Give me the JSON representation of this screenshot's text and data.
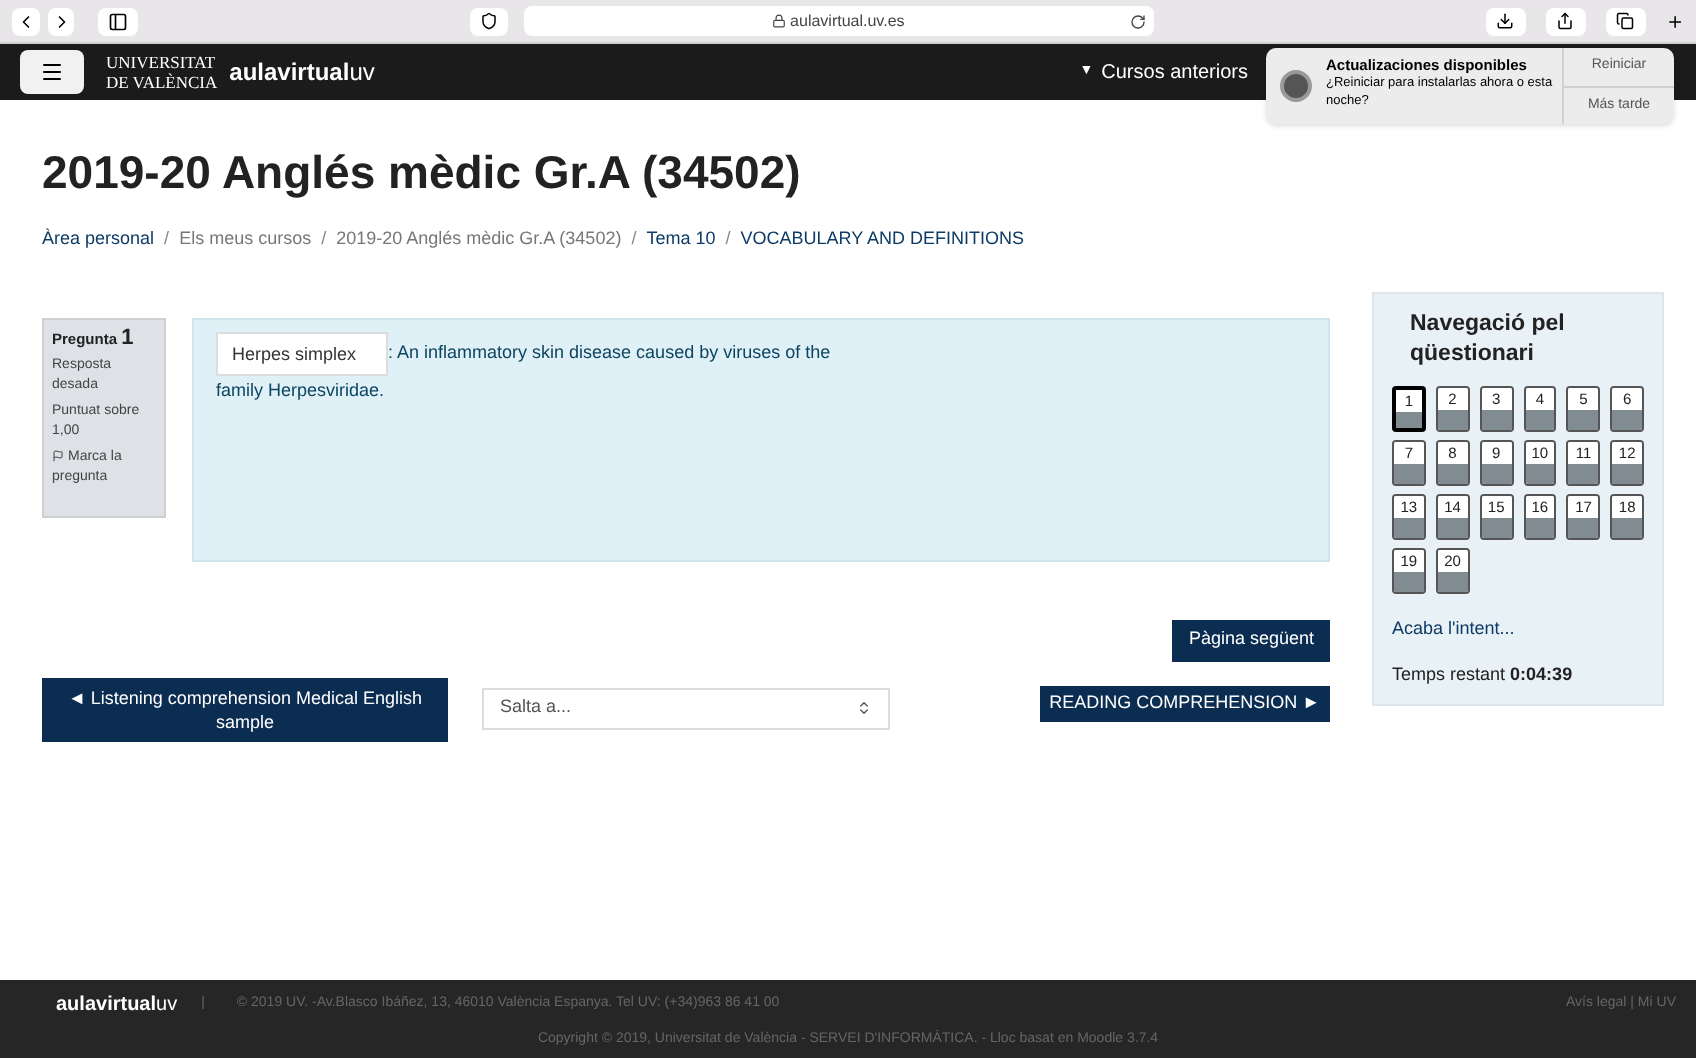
{
  "browser": {
    "url": "aulavirtual.uv.es"
  },
  "navbar": {
    "university": [
      "UNIVERSITAT",
      "DE VALÈNCIA"
    ],
    "logo": {
      "main": "aulavirtual",
      "suffix": "uv"
    },
    "menu_caret": "▼",
    "menu": "Cursos anteriors"
  },
  "notification": {
    "title": "Actualizaciones disponibles",
    "message": "¿Reiniciar para instalarlas ahora o esta noche?",
    "actions": [
      "Reiniciar",
      "Más tarde"
    ]
  },
  "page_title": "2019-20 Anglés mèdic Gr.A (34502)",
  "breadcrumb": {
    "separators": [
      "/",
      "/",
      "/",
      "/"
    ],
    "items": [
      {
        "label": "Àrea personal",
        "link": true
      },
      {
        "label": "Els meus cursos",
        "link": false
      },
      {
        "label": "2019-20 Anglés mèdic Gr.A (34502)",
        "link": false
      },
      {
        "label": "Tema 10",
        "link": true
      },
      {
        "label": "VOCABULARY AND DEFINITIONS",
        "link": true
      }
    ]
  },
  "question_info": {
    "label": "Pregunta",
    "number": "1",
    "status": "Resposta desada",
    "grade": "Puntuat sobre 1,00",
    "flag": "Marca la pregunta"
  },
  "question": {
    "answer": "Herpes simplex",
    "text_lines": [
      ": An inflammatory skin disease caused by viruses of the",
      "family Herpesviridae."
    ]
  },
  "next_page": "Pàgina següent",
  "prev_activity": "◄ Listening comprehension Medical English sample",
  "jump": {
    "placeholder": "Salta a..."
  },
  "next_activity": "READING COMPREHENSION ►",
  "quiz_nav": {
    "title": "Navegació pel qüestionari",
    "questions": [
      {
        "label": "1",
        "selected": true
      },
      {
        "label": "2",
        "selected": false
      },
      {
        "label": "3",
        "selected": false
      },
      {
        "label": "4",
        "selected": false
      },
      {
        "label": "5",
        "selected": false
      },
      {
        "label": "6",
        "selected": false
      },
      {
        "label": "7",
        "selected": false
      },
      {
        "label": "8",
        "selected": false
      },
      {
        "label": "9",
        "selected": false
      },
      {
        "label": "10",
        "selected": false
      },
      {
        "label": "11",
        "selected": false
      },
      {
        "label": "12",
        "selected": false
      },
      {
        "label": "13",
        "selected": false
      },
      {
        "label": "14",
        "selected": false
      },
      {
        "label": "15",
        "selected": false
      },
      {
        "label": "16",
        "selected": false
      },
      {
        "label": "17",
        "selected": false
      },
      {
        "label": "18",
        "selected": false
      },
      {
        "label": "19",
        "selected": false
      },
      {
        "label": "20",
        "selected": false
      }
    ],
    "finish": "Acaba l'intent...",
    "time_label": "Temps restant",
    "time": "0:04:39"
  },
  "footer": {
    "logo": {
      "main": "aulavirtual",
      "suffix": "uv"
    },
    "separator": "|",
    "address": "© 2019 UV. -Av.Blasco Ibáñez, 13, 46010 València Espanya. Tel UV: (+34)963 86 41 00",
    "links": "Avís legal | Mi UV",
    "copyright": "Copyright © 2019, Universitat de València - SERVEI D'INFORMÀTICA.  - Lloc basat en Moodle 3.7.4"
  }
}
